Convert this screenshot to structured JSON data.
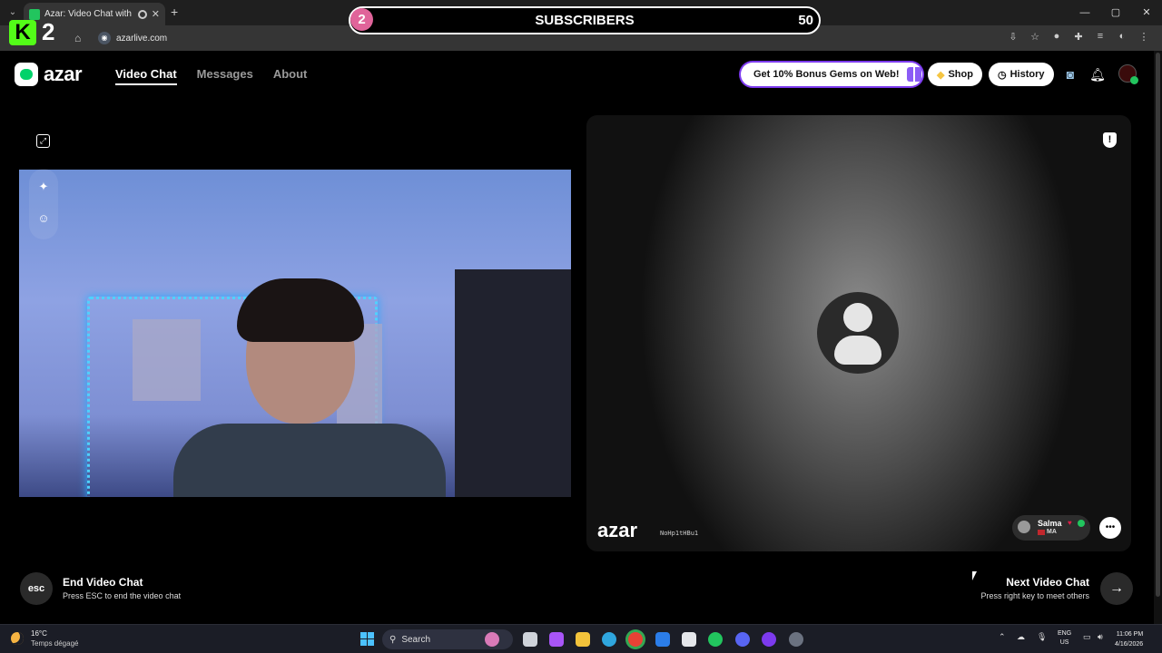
{
  "browser": {
    "tab_title": "Azar: Video Chat with New",
    "tab_close": "✕",
    "new_tab": "+",
    "url": "azarlive.com",
    "window": {
      "minimize": "—",
      "maximize": "▢",
      "close": "✕"
    }
  },
  "overlay": {
    "kick_letter": "K",
    "kick_count": "2",
    "sub_number": "2",
    "sub_label": "SUBSCRIBERS",
    "sub_goal": "50"
  },
  "site": {
    "logo_text": "azar",
    "nav": [
      {
        "label": "Video Chat",
        "active": true
      },
      {
        "label": "Messages",
        "active": false
      },
      {
        "label": "About",
        "active": false
      }
    ],
    "promo_text": "Get 10% Bonus Gems on Web!",
    "shop_label": "Shop",
    "history_label": "History"
  },
  "chat": {
    "watermark_logo": "azar",
    "watermark_id": "NoHp1tHBu1",
    "peer_name": "Salma",
    "peer_country": "MA",
    "report_icon_text": "!",
    "expand_icon": "⤢",
    "magic_icon": "✦",
    "sticker_icon": "☺"
  },
  "controls": {
    "esc_label": "esc",
    "end_title": "End Video Chat",
    "end_sub": "Press ESC to end the video chat",
    "next_title": "Next Video Chat",
    "next_sub": "Press right key to meet others",
    "next_arrow": "→"
  },
  "taskbar": {
    "temp": "16°C",
    "weather": "Temps dégagé",
    "search_placeholder": "Search",
    "lang_line1": "ENG",
    "lang_line2": "US",
    "time": "11:06 PM",
    "date": "4/16/2026"
  }
}
